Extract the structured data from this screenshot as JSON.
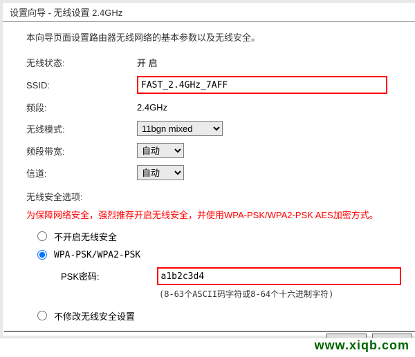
{
  "title": "设置向导 - 无线设置 2.4GHz",
  "intro": "本向导页面设置路由器无线网络的基本参数以及无线安全。",
  "fields": {
    "status": {
      "label": "无线状态:",
      "value": "开 启"
    },
    "ssid": {
      "label": "SSID:",
      "value": "FAST_2.4GHz_7AFF"
    },
    "band": {
      "label": "频段:",
      "value": "2.4GHz"
    },
    "mode": {
      "label": "无线模式:",
      "value": "11bgn mixed"
    },
    "bandwidth": {
      "label": "频段带宽:",
      "value": "自动"
    },
    "channel": {
      "label": "信道:",
      "value": "自动"
    }
  },
  "security": {
    "title": "无线安全选项:",
    "warning": "为保障网络安全，强烈推荐开启无线安全，并使用WPA-PSK/WPA2-PSK AES加密方式。",
    "radio_off": "不开启无线安全",
    "radio_wpa": "WPA-PSK/WPA2-PSK",
    "psk_label": "PSK密码:",
    "psk_value": "a1b2c3d4",
    "psk_hint": "(8-63个ASCII码字符或8-64个十六进制字符)",
    "radio_nomod": "不修改无线安全设置"
  },
  "watermark": "www.xiqb.com"
}
